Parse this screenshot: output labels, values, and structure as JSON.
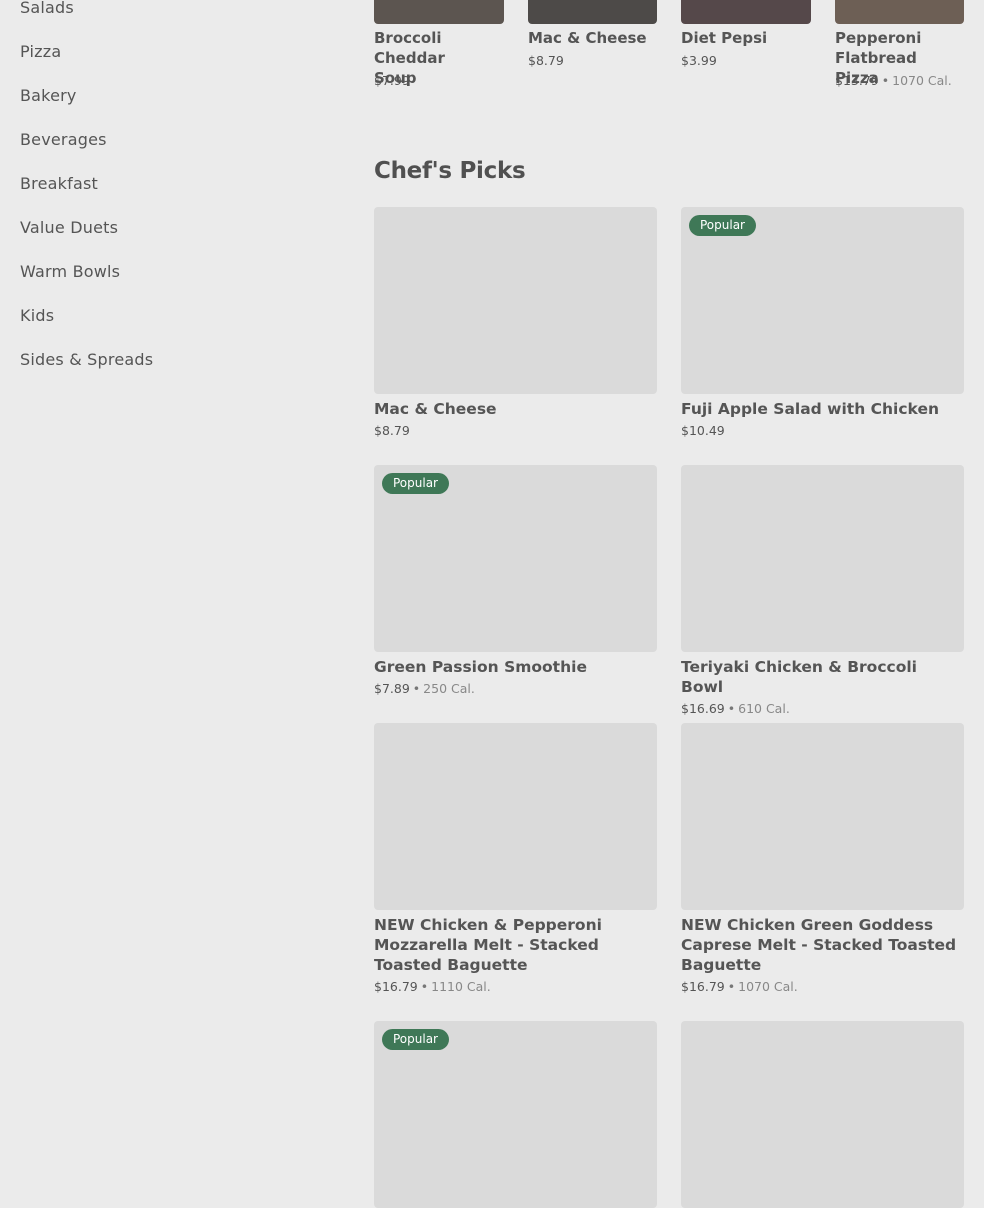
{
  "sidebar": {
    "items": [
      {
        "label": "Salads"
      },
      {
        "label": "Pizza"
      },
      {
        "label": "Bakery"
      },
      {
        "label": "Beverages"
      },
      {
        "label": "Breakfast"
      },
      {
        "label": "Value Duets"
      },
      {
        "label": "Warm Bowls"
      },
      {
        "label": "Kids"
      },
      {
        "label": "Sides & Spreads"
      }
    ]
  },
  "top_row": [
    {
      "name_line1": "Broccoli Cheddar",
      "name_line2": "Soup",
      "price": "$7.99",
      "calories": ""
    },
    {
      "name_line1": "Mac & Cheese",
      "name_line2": "",
      "price": "$8.79",
      "calories": ""
    },
    {
      "name_line1": "Diet Pepsi",
      "name_line2": "",
      "price": "$3.99",
      "calories": ""
    },
    {
      "name_line1": "Pepperoni",
      "name_line2": "Flatbread Pizza",
      "price": "$13.79",
      "calories": "1070 Cal."
    }
  ],
  "section": {
    "title": "Chef's Picks"
  },
  "cards": [
    {
      "badge": "",
      "name": "Mac & Cheese",
      "price": "$8.79",
      "calories": ""
    },
    {
      "badge": "Popular",
      "name": "Fuji Apple Salad with Chicken",
      "price": "$10.49",
      "calories": ""
    },
    {
      "badge": "Popular",
      "name": "Green Passion Smoothie",
      "price": "$7.89",
      "calories": "250 Cal."
    },
    {
      "badge": "",
      "name": "Teriyaki Chicken & Broccoli Bowl",
      "price": "$16.69",
      "calories": "610 Cal."
    },
    {
      "badge": "",
      "name": "NEW Chicken & Pepperoni Mozzarella Melt - Stacked Toasted Baguette",
      "price": "$16.79",
      "calories": "1110 Cal."
    },
    {
      "badge": "",
      "name": "NEW Chicken Green Goddess Caprese Melt - Stacked Toasted Baguette",
      "price": "$16.79",
      "calories": "1070 Cal."
    },
    {
      "badge": "Popular",
      "name": "",
      "price": "",
      "calories": ""
    },
    {
      "badge": "",
      "name": "",
      "price": "",
      "calories": ""
    }
  ],
  "colors": {
    "badge": "#3f7857",
    "background": "#ebebeb",
    "image_placeholder": "#dadada"
  }
}
